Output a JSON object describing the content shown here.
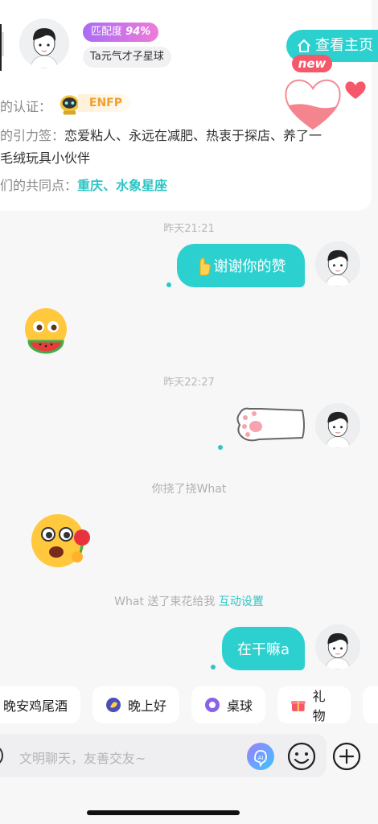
{
  "profile": {
    "match_label": "匹配度",
    "match_value": "94%",
    "planet": "Ta元气才子星球",
    "home_button": "查看主页",
    "new_badge": "new",
    "cert_label": "的认证：",
    "mbti": "ENFP",
    "tags_label": "的引力签：",
    "tags_line1": "恋爱粘人、永远在减肥、热衷于探店、养了一",
    "tags_line2": "毛绒玩具小伙伴",
    "common_label": "们的共同点：",
    "common_value": "重庆、水象星座"
  },
  "chat": {
    "time1": "昨天21:21",
    "msg1": "谢谢你的赞",
    "time2": "昨天22:27",
    "notice1": "你挠了挠What",
    "notice2_text": "What 送了束花给我",
    "notice2_link": "互动设置",
    "msg2": "在干嘛a"
  },
  "quick_replies": [
    {
      "label": "晚安鸡尾酒",
      "icon": "cocktail-icon"
    },
    {
      "label": "晚上好",
      "icon": "moon-icon"
    },
    {
      "label": "桌球",
      "icon": "billiard-ball-icon"
    },
    {
      "label": "礼物",
      "icon": "gift-icon"
    }
  ],
  "input": {
    "placeholder": "文明聊天，友善交友~",
    "ai_label": "AI"
  },
  "colors": {
    "accent": "#2cd0cf",
    "match_gradient_start": "#a96cf6",
    "match_gradient_end": "#ef7bd8",
    "new_badge": "#f5586a",
    "mbti_orange": "#f0a030"
  }
}
